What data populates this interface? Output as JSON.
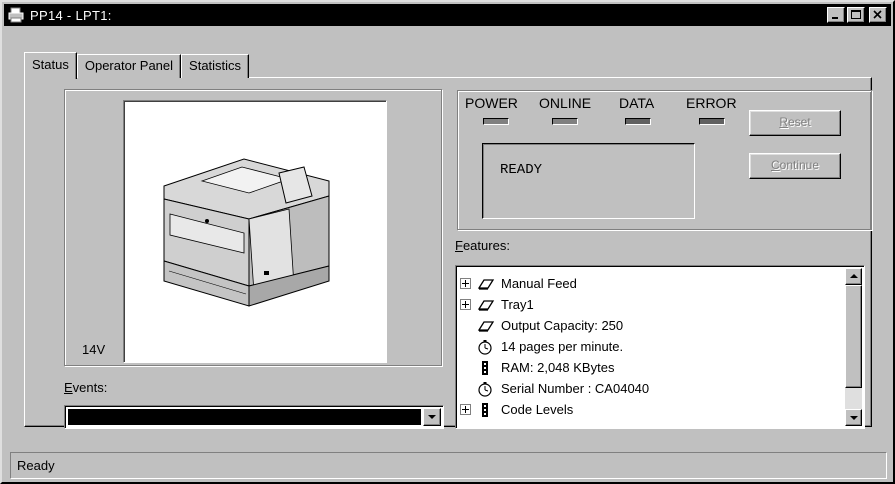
{
  "window": {
    "title": "PP14 - LPT1:"
  },
  "tabs": [
    {
      "label": "Status",
      "active": true
    },
    {
      "label": "Operator Panel",
      "active": false
    },
    {
      "label": "Statistics",
      "active": false
    }
  ],
  "printer": {
    "model_label": "14V"
  },
  "events": {
    "label_accel": "E",
    "label_rest": "vents:",
    "selected_value": ""
  },
  "indicators": [
    {
      "label": "POWER",
      "state": "off"
    },
    {
      "label": "ONLINE",
      "state": "off"
    },
    {
      "label": "DATA",
      "state": "on"
    },
    {
      "label": "ERROR",
      "state": "on"
    }
  ],
  "display": {
    "text": "READY"
  },
  "buttons": {
    "reset": {
      "accel": "R",
      "rest": "eset",
      "enabled": false
    },
    "continue": {
      "accel": "C",
      "rest": "ontinue",
      "enabled": false
    }
  },
  "features": {
    "label_accel": "F",
    "label_rest": "eatures:",
    "items": [
      {
        "label": "Manual Feed",
        "expandable": true,
        "icon": "paper-tray-icon"
      },
      {
        "label": "Tray1",
        "expandable": true,
        "icon": "paper-tray-icon"
      },
      {
        "label": "Output Capacity: 250",
        "expandable": false,
        "icon": "paper-tray-icon"
      },
      {
        "label": "14 pages per minute.",
        "expandable": false,
        "icon": "stopwatch-icon"
      },
      {
        "label": "RAM:   2,048 KBytes",
        "expandable": false,
        "icon": "memory-chip-icon"
      },
      {
        "label": "Serial Number :  CA04040",
        "expandable": false,
        "icon": "stopwatch-icon"
      },
      {
        "label": "Code Levels",
        "expandable": true,
        "icon": "memory-chip-icon"
      }
    ]
  },
  "statusbar": {
    "text": "Ready"
  }
}
